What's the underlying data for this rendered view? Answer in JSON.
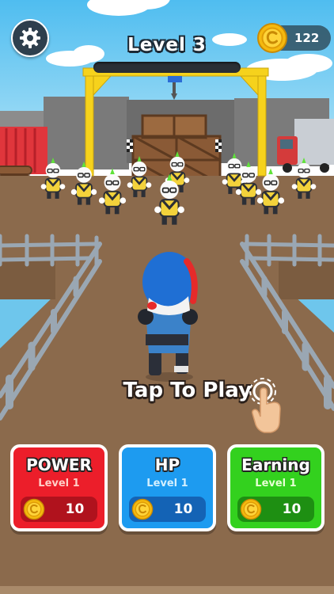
{
  "hud": {
    "settings_icon": "gear-icon",
    "level_title": "Level 3",
    "level_progress": 0,
    "coin_icon": "coin-icon",
    "coin_balance": "122"
  },
  "prompt": {
    "text": "Tap To Play",
    "hand_icon": "tap-hand-icon"
  },
  "upgrades": [
    {
      "title": "POWER",
      "level": "Level 1",
      "cost": "10",
      "color": "#ec1e2a"
    },
    {
      "title": "HP",
      "level": "Level 1",
      "cost": "10",
      "color": "#1d9bf0"
    },
    {
      "title": "Earning",
      "level": "Level 1",
      "cost": "10",
      "color": "#33d11e"
    }
  ],
  "colors": {
    "ground": "#8b6a4c",
    "sky": "#63c7f2",
    "enemy_shirt": "#f3d23b",
    "player_helmet": "#1f6fd4",
    "gantry": "#f6d21c"
  }
}
